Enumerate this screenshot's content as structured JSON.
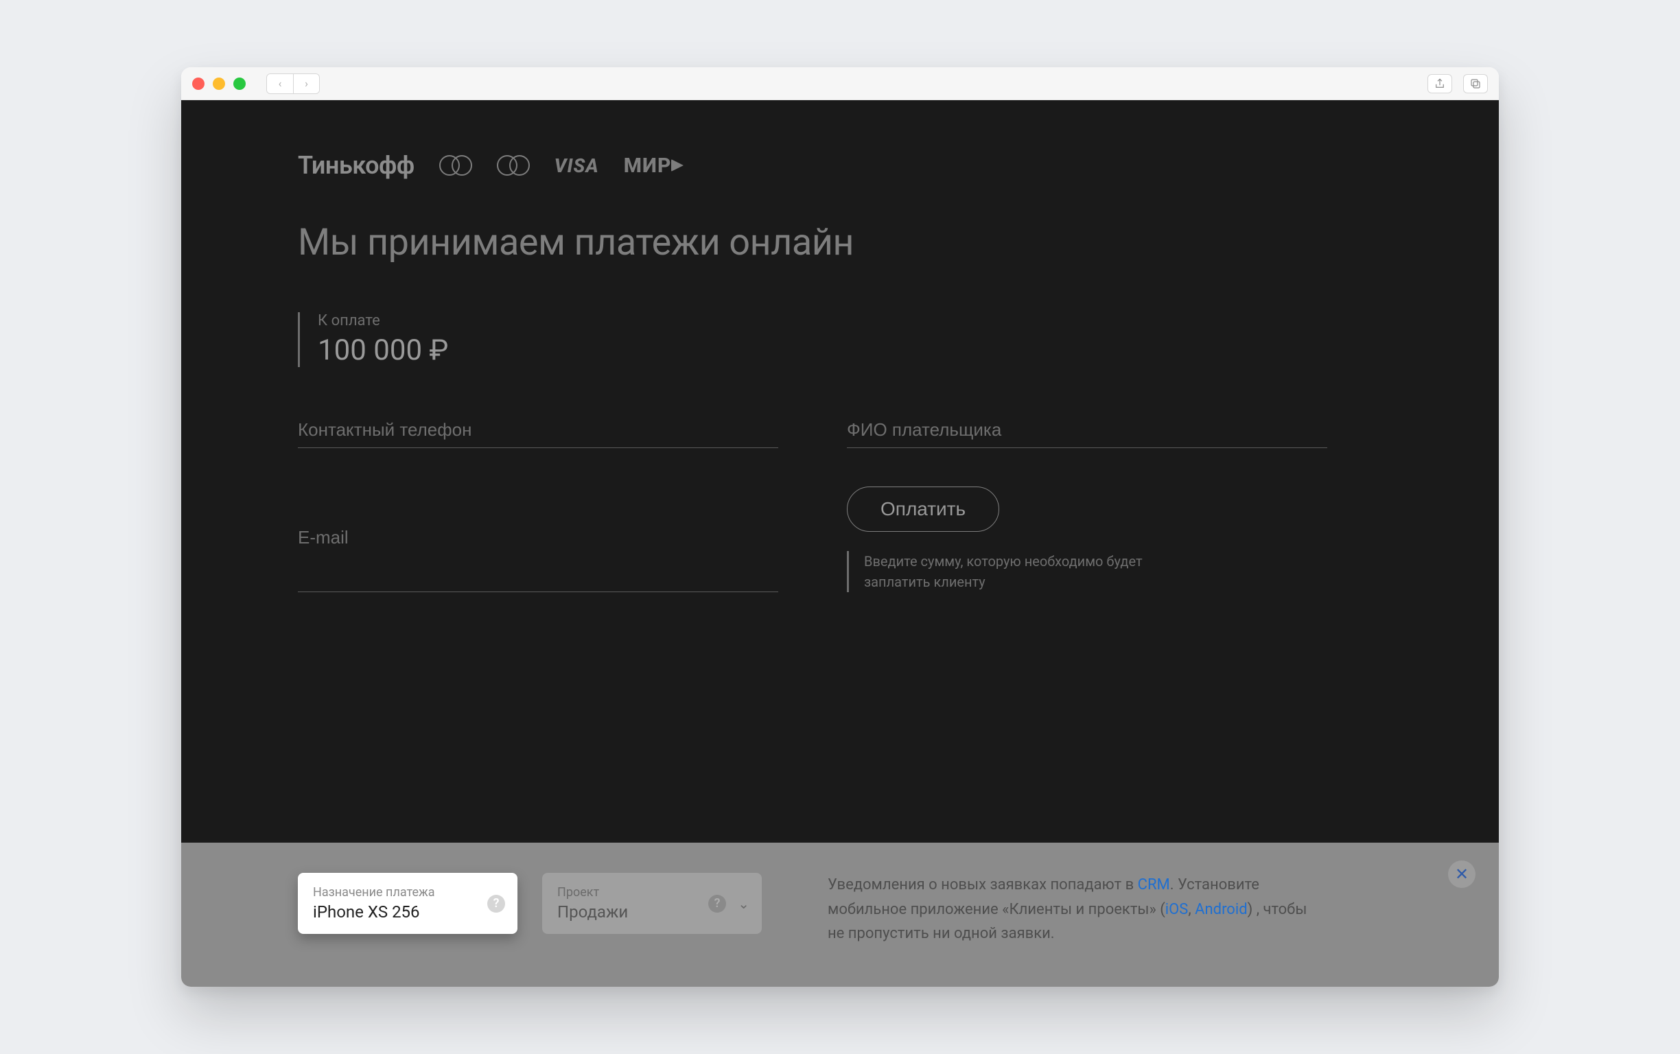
{
  "brand": {
    "name": "Тинькофф",
    "visa": "VISA",
    "mir": "МИР"
  },
  "headline": "Мы принимаем платежи онлайн",
  "amount": {
    "label": "К оплате",
    "value": "100 000 ₽"
  },
  "fields": {
    "phone_placeholder": "Контактный телефон",
    "name_placeholder": "ФИО плательщика",
    "email_placeholder": "E-mail"
  },
  "pay_button": "Оплатить",
  "hint": "Введите сумму, которую необходимо будет заплатить клиенту",
  "bottom": {
    "purpose": {
      "label": "Назначение платежа",
      "value": "iPhone XS 256"
    },
    "project": {
      "label": "Проект",
      "value": "Продажи"
    },
    "notice": {
      "part1": "Уведомления о новых заявках попадают в ",
      "crm": "CRM",
      "part2": ". Установите мобильное приложение «Клиенты и проекты» (",
      "ios": "iOS",
      "comma": ", ",
      "android": "Android",
      "part3": ") , чтобы не пропустить ни одной заявки."
    }
  }
}
